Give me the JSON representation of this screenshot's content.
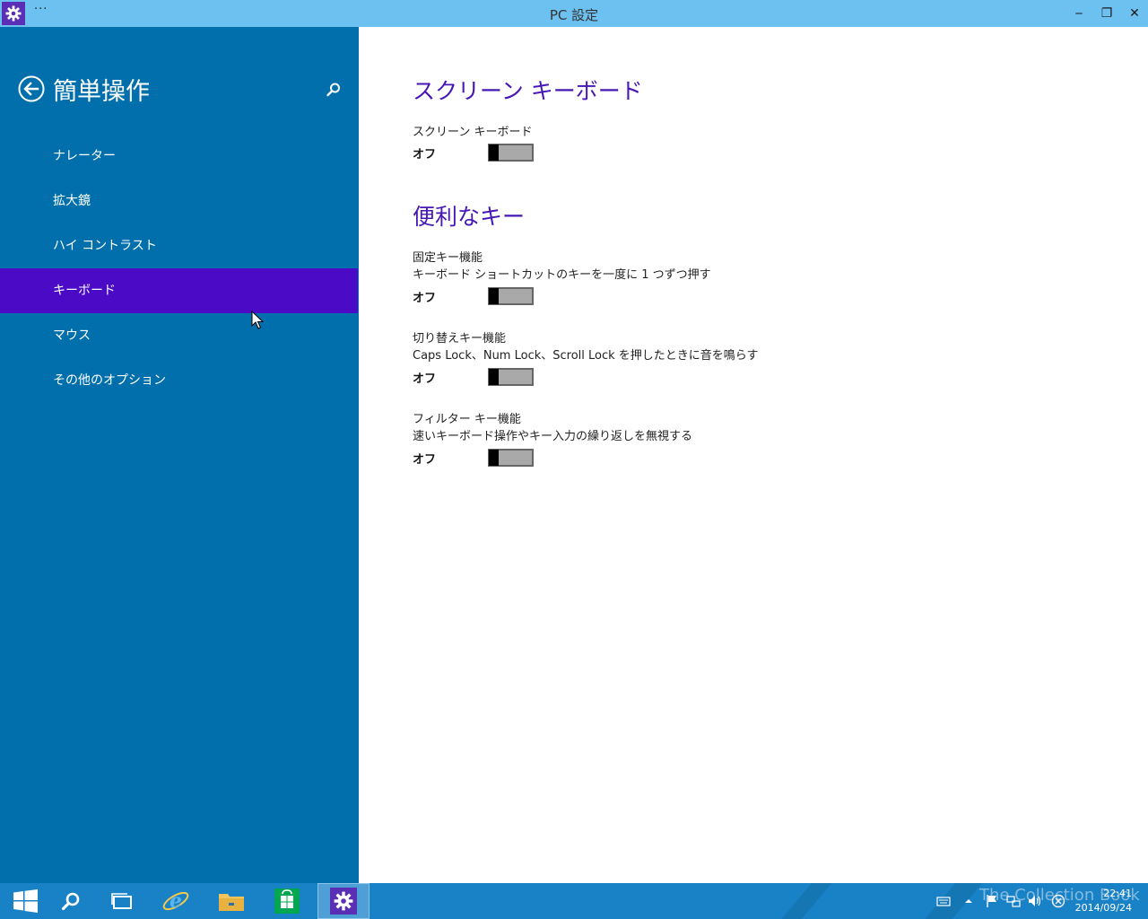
{
  "window": {
    "title": "PC 設定",
    "menu_label": "···",
    "minimize_glyph": "‒",
    "restore_glyph": "❐",
    "close_glyph": "✕"
  },
  "sidebar": {
    "title": "簡単操作",
    "items": [
      {
        "label": "ナレーター",
        "active": false
      },
      {
        "label": "拡大鏡",
        "active": false
      },
      {
        "label": "ハイ コントラスト",
        "active": false
      },
      {
        "label": "キーボード",
        "active": true
      },
      {
        "label": "マウス",
        "active": false
      },
      {
        "label": "その他のオプション",
        "active": false
      }
    ]
  },
  "content": {
    "sections": [
      {
        "title": "スクリーン キーボード",
        "settings": [
          {
            "label": "スクリーン キーボード",
            "description": "",
            "state": "オフ",
            "on": false
          }
        ]
      },
      {
        "title": "便利なキー",
        "settings": [
          {
            "label": "固定キー機能",
            "description": "キーボード ショートカットのキーを一度に 1 つずつ押す",
            "state": "オフ",
            "on": false
          },
          {
            "label": "切り替えキー機能",
            "description": "Caps Lock、Num Lock、Scroll Lock を押したときに音を鳴らす",
            "state": "オフ",
            "on": false
          },
          {
            "label": "フィルター キー機能",
            "description": "速いキーボード操作やキー入力の繰り返しを無視する",
            "state": "オフ",
            "on": false
          }
        ]
      }
    ]
  },
  "taskbar": {
    "buttons": [
      "start-icon",
      "search-icon",
      "task-view-icon",
      "internet-explorer-icon",
      "file-explorer-icon",
      "store-icon",
      "settings-icon"
    ],
    "active_button": "settings-icon",
    "tray_icons": [
      "keyboard-icon",
      "show-hidden-icon",
      "flag-icon",
      "network-icon",
      "volume-icon",
      "power-icon"
    ],
    "time": "22:41",
    "date": "2014/09/24",
    "watermark": "The Collection Book"
  },
  "colors": {
    "titlebar": "#6cc1f0",
    "sidebar": "#006fac",
    "sidebar_active": "#4a0ac6",
    "accent": "#4617b4",
    "taskbar": "#1981c5"
  }
}
